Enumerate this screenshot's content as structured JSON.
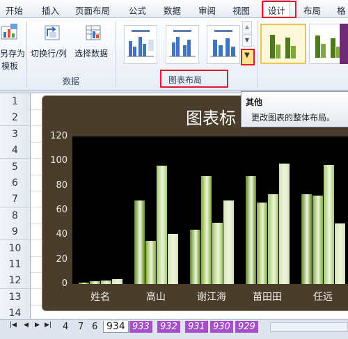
{
  "ribbon": {
    "tabs": [
      "开始",
      "插入",
      "页面布局",
      "公式",
      "数据",
      "审阅",
      "视图",
      "设计",
      "布局",
      "格"
    ],
    "active_tab": "设计",
    "save_template_label_1": "另存为",
    "save_template_label_2": "模板",
    "switch_row_col_label": "切换行/列",
    "select_data_label": "选择数据",
    "data_group_label": "数据",
    "chart_layout_group_label": "图表布局",
    "more_button_arrow": "▼"
  },
  "tooltip": {
    "title": "其他",
    "description": "更改图表的整体布局。"
  },
  "sheet": {
    "row_numbers": [
      "1",
      "2",
      "3",
      "4",
      "5",
      "6",
      "7",
      "8",
      "9",
      "10",
      "11",
      "12",
      "13",
      "14"
    ]
  },
  "chart_data": {
    "type": "bar",
    "title": "图表标",
    "categories": [
      "姓名",
      "高山",
      "谢江海",
      "苗田田",
      "任远"
    ],
    "ylim": [
      0,
      120
    ],
    "yticks": [
      "0",
      "20",
      "40",
      "60",
      "80",
      "100",
      "120"
    ],
    "series": [
      {
        "values": [
          1,
          68,
          44,
          88,
          73
        ]
      },
      {
        "values": [
          2,
          35,
          88,
          66,
          72
        ]
      },
      {
        "values": [
          3,
          96,
          50,
          73,
          97
        ]
      },
      {
        "values": [
          4,
          41,
          68,
          98,
          49
        ]
      }
    ],
    "colors": {
      "series": [
        "#5f8a22",
        "#7fa93a",
        "#a5c86b",
        "#d4e2b8"
      ],
      "plot_background": "#000000",
      "chart_background": "#4a3d2c"
    },
    "grid": false
  },
  "sheet_tabs": {
    "tabs": [
      "4",
      "7",
      "6",
      "934",
      "933",
      "932",
      "931",
      "930",
      "929"
    ],
    "current": "934"
  }
}
